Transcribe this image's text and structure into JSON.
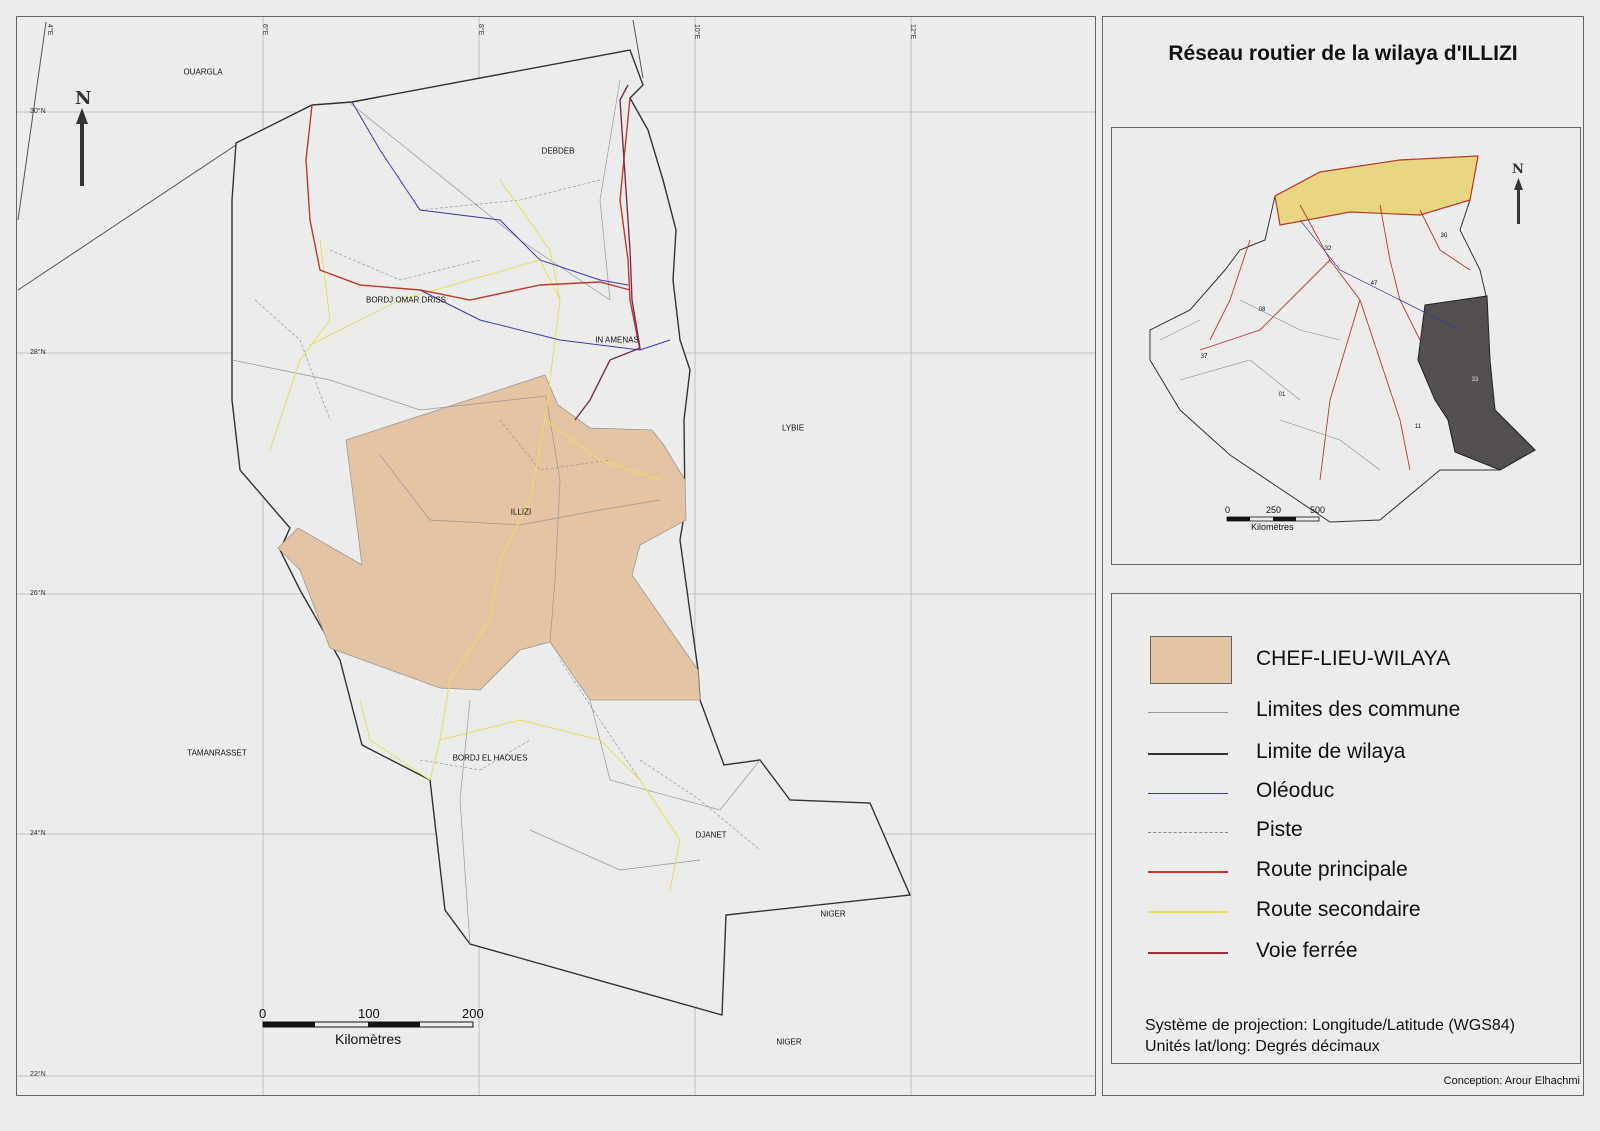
{
  "title": "Réseau routier de la wilaya d'ILLIZI",
  "map": {
    "north_label": "N",
    "places": {
      "ouargla": "OUARGLA",
      "debdeb": "DEBDEB",
      "bordj_omar_driss": "BORDJ OMAR DRISS",
      "in_amenas": "IN AMENAS",
      "lybie": "LYBIE",
      "illizi": "ILLIZI",
      "tamanrasset": "TAMANRASSET",
      "bordj_el_haoues": "BORDJ EL HAOUES",
      "djanet": "DJANET",
      "niger_1": "NIGER",
      "niger_2": "NIGER"
    },
    "lat_ticks": [
      "30°N",
      "28°N",
      "26°N",
      "24°N",
      "22°N"
    ],
    "lon_ticks": [
      "4°E",
      "6°E",
      "8°E",
      "10°E",
      "12°E"
    ],
    "scale": {
      "tick_0": "0",
      "tick_1": "100",
      "tick_2": "200",
      "unit": "Kilomètres"
    }
  },
  "inset": {
    "north_label": "N",
    "scale": {
      "tick_0": "0",
      "tick_1": "250",
      "tick_2": "500",
      "unit": "Kilomètres"
    },
    "codes": [
      "32",
      "47",
      "30",
      "08",
      "37",
      "01",
      "33",
      "11"
    ]
  },
  "legend": {
    "chef_lieu": "CHEF-LIEU-WILAYA",
    "items": [
      {
        "label": "Limites des commune",
        "color": "#9a9a9a"
      },
      {
        "label": "Limite de wilaya",
        "color": "#333333"
      },
      {
        "label": "Oléoduc",
        "color": "#3a3ab0"
      },
      {
        "label": "Piste",
        "color": "#8c8c8c"
      },
      {
        "label": "Route principale",
        "color": "#c0392b"
      },
      {
        "label": "Route secondaire",
        "color": "#e8e060"
      },
      {
        "label": "Voie ferrée",
        "color": "#a0303a"
      }
    ],
    "chef_lieu_color": "#e5c4a3"
  },
  "projection": {
    "line1": "Système de projection: Longitude/Latitude (WGS84)",
    "line2": "Unités lat/long: Degrés décimaux"
  },
  "credit": "Conception: Arour Elhachmi"
}
